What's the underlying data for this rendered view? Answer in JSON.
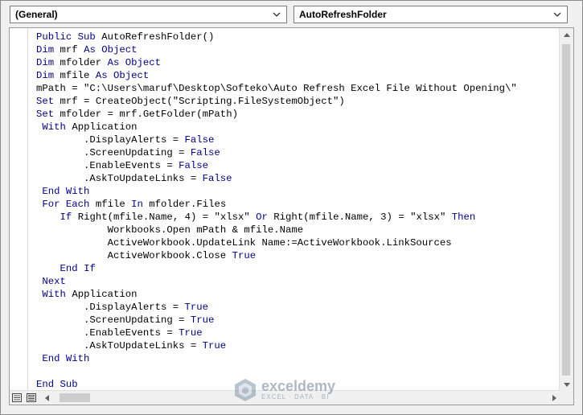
{
  "header": {
    "object_dropdown": "(General)",
    "procedure_dropdown": "AutoRefreshFolder"
  },
  "code": {
    "lines": [
      "Public Sub AutoRefreshFolder()",
      "Dim mrf As Object",
      "Dim mfolder As Object",
      "Dim mfile As Object",
      "mPath = \"C:\\Users\\maruf\\Desktop\\Softeko\\Auto Refresh Excel File Without Opening\\\"",
      "Set mrf = CreateObject(\"Scripting.FileSystemObject\")",
      "Set mfolder = mrf.GetFolder(mPath)",
      " With Application",
      "        .DisplayAlerts = False",
      "        .ScreenUpdating = False",
      "        .EnableEvents = False",
      "        .AskToUpdateLinks = False",
      " End With",
      " For Each mfile In mfolder.Files",
      "    If Right(mfile.Name, 4) = \"xlsx\" Or Right(mfile.Name, 3) = \"xlsx\" Then",
      "            Workbooks.Open mPath & mfile.Name",
      "            ActiveWorkbook.UpdateLink Name:=ActiveWorkbook.LinkSources",
      "            ActiveWorkbook.Close True",
      "    End If",
      " Next",
      " With Application",
      "        .DisplayAlerts = True",
      "        .ScreenUpdating = True",
      "        .EnableEvents = True",
      "        .AskToUpdateLinks = True",
      " End With",
      "",
      "End Sub"
    ],
    "keywords": [
      "Public",
      "Sub",
      "Dim",
      "As",
      "Object",
      "Set",
      "With",
      "End",
      "False",
      "True",
      "For",
      "Each",
      "In",
      "If",
      "Or",
      "Then",
      "Next"
    ],
    "keyword_color": "#00008b"
  },
  "watermark": {
    "name": "exceldemy",
    "tagline": "EXCEL · DATA · BI"
  },
  "icons": {
    "dropdown_arrow": "chevron-down-icon",
    "procedure_view": "procedure-view-icon",
    "full_module_view": "full-module-view-icon"
  }
}
